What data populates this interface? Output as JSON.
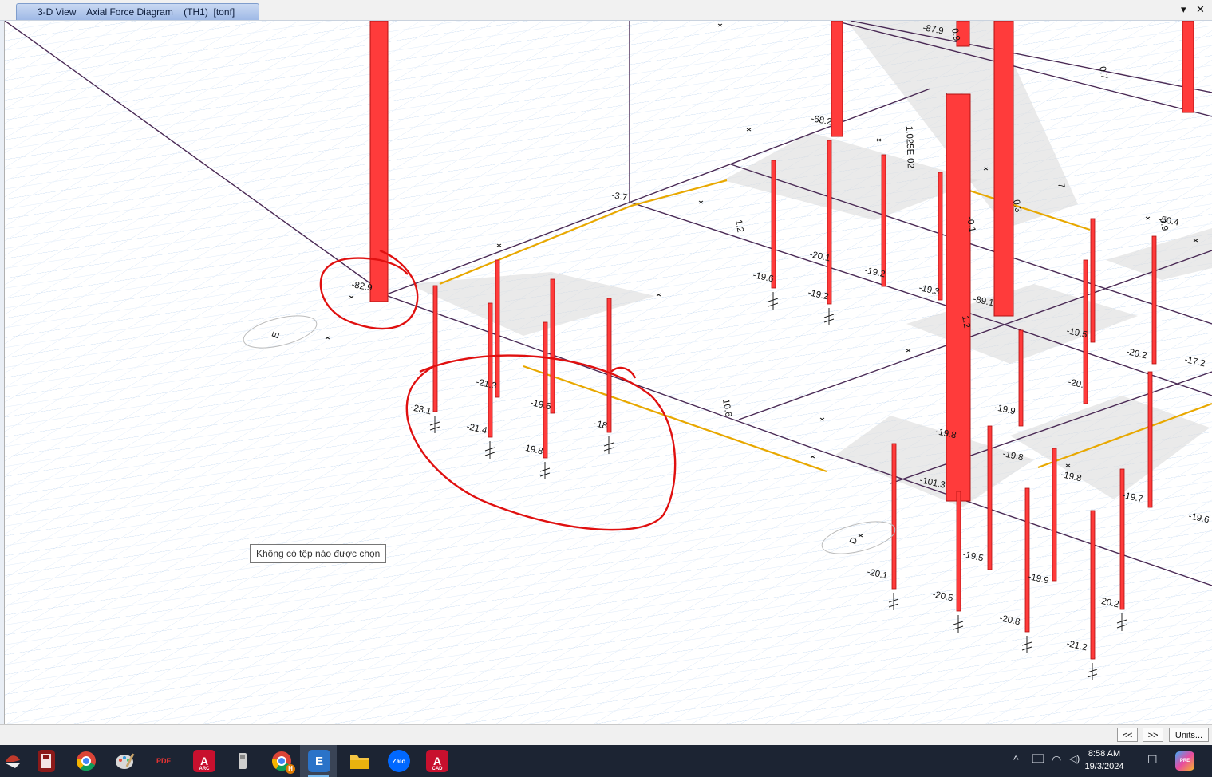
{
  "window": {
    "tab_title": "3-D View    Axial Force Diagram    (TH1)  [tonf]",
    "minimize_glyph": "▾",
    "close_glyph": "✕"
  },
  "tooltip": {
    "text": "Không có tệp nào được chọn"
  },
  "model": {
    "grid_bubbles": [
      "E",
      "D"
    ],
    "labels_left": [
      "-82.9",
      "-3.7",
      "-23.1",
      "-21.4",
      "-19.8",
      "-19.6",
      "-21.3",
      "-18",
      "10.6",
      "1.2"
    ],
    "labels_center": [
      "-68.2",
      "-87.9",
      "1.025E-02",
      "-19.6",
      "-20.1",
      "-19.2",
      "-19.2",
      "-19.3",
      "-0.1",
      "0.3",
      "0.9",
      "-89.1",
      "-101.3",
      "0.7",
      "7",
      "1.2"
    ],
    "labels_right": [
      "-50.4",
      "-19.5",
      "-20.2",
      "-17.2",
      "-20.",
      "-19.9",
      "-19.8",
      "-19.8",
      "-19.8",
      "-19.7",
      "-19.6",
      "-19.5",
      "-20.1",
      "-20.5",
      "-20.8",
      "-19.9",
      "-20.2",
      "-21.2",
      "9.9"
    ],
    "colors": {
      "force_fill": "#ff3b3b",
      "force_edge": "#b01010",
      "beam": "#4a2a55",
      "beam_highlight": "#e8a800",
      "grid": "#c9dcf2",
      "markup": "#e01010"
    }
  },
  "statusbar": {
    "prev_label": "<<",
    "next_label": ">>",
    "units_label": "Units..."
  },
  "taskbar": {
    "apps": [
      "start",
      "calculator",
      "chrome",
      "paint",
      "pdf",
      "autocad-arc",
      "usb",
      "chrome-profile",
      "etabs",
      "file-explorer",
      "zalo",
      "autocad"
    ],
    "icon_texts": {
      "pdf": "PDF",
      "autocad_arc": "A",
      "autocad_arc_sub": "ARC",
      "autocad": "A",
      "autocad_sub": "CAD",
      "zalo": "Zalo",
      "etabs": "E",
      "chrome_badge": "H",
      "copilot_badge": "PRE"
    },
    "tray_glyphs": {
      "chevron": "^",
      "wifi": "◠",
      "volume": "◁)",
      "notification": "☐"
    },
    "time": "8:58 AM",
    "date": "19/3/2024"
  }
}
